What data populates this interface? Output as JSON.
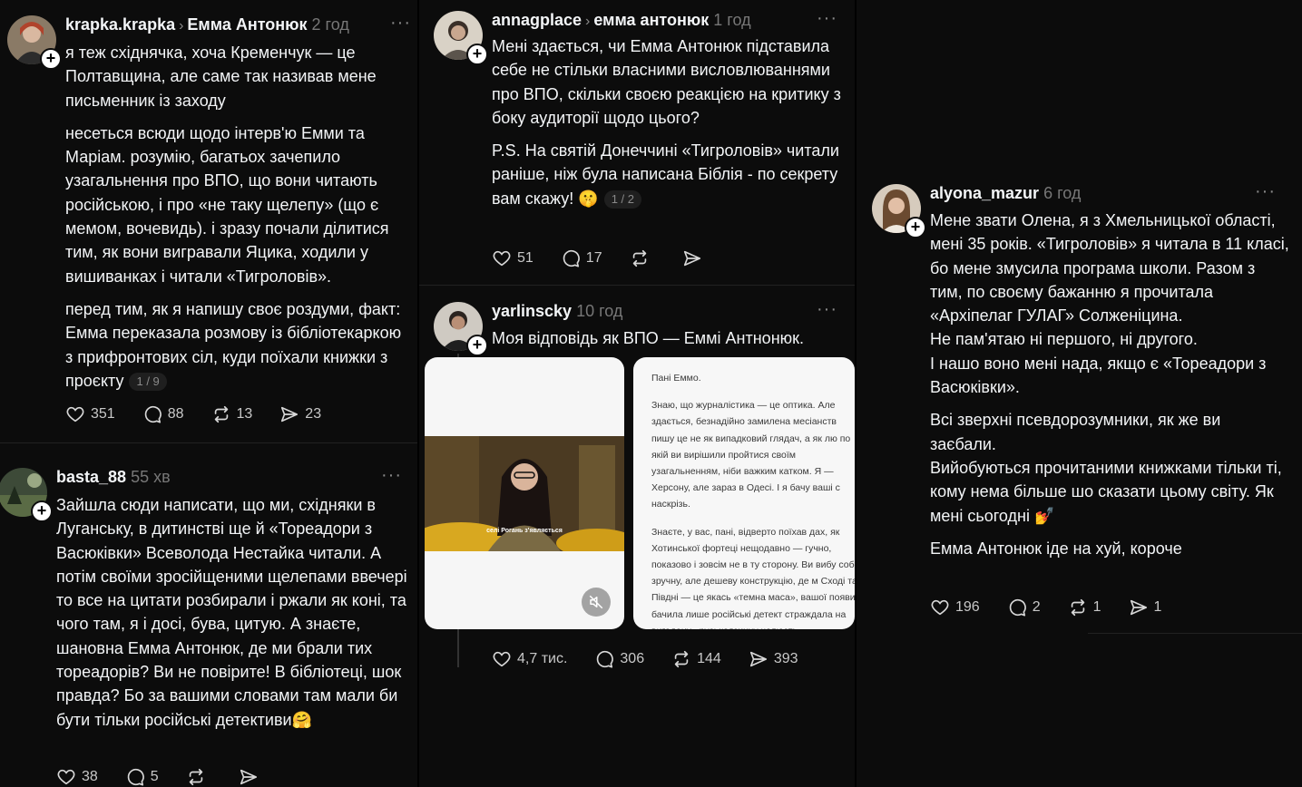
{
  "posts": [
    {
      "username": "krapka.krapka",
      "reply_to": "Емма Антонюк",
      "time": "2 год",
      "paragraphs": [
        "я теж східнячка, хоча Кременчук — це Полтавщина, але саме так називав мене письменник із заходу",
        "несеться всюди щодо інтерв'ю Емми та Маріам. розумію, багатьох зачепило узагальнення про ВПО, що вони читають російською, і про «не таку щелепу» (що є мемом, вочевидь). і зразу почали ділитися тим, як вони вигравали Яцика, ходили у вишиванках і читали «Тигроловів».",
        "перед тим, як я напишу своє роздуми, факт: Емма переказала розмову із бібліотекаркою з прифронтових сіл, куди поїхали книжки з проєкту"
      ],
      "pager": "1 / 9",
      "likes": "351",
      "comments": "88",
      "reposts": "13",
      "shares": "23",
      "avatar": "person-avatar"
    },
    {
      "username": "basta_88",
      "time": "55 хв",
      "paragraphs": [
        "Зайшла сюди написати, що ми, східняки в Луганську, в дитинстві ще й «Тореадори з Васюківки» Всеволода Нестайка читали. А потім своїми зросійщеними щелепами ввечері то все на цитати розбирали і ржали як коні, та чого там, я і досі, бува, цитую. А знаєте, шановна Емма Антонюк, де ми брали тих тореадорів? Ви не повірите! В бібліотеці, шок правда? Бо за вашими словами там мали би бути тільки російські детективи🤗"
      ],
      "likes": "38",
      "comments": "5",
      "avatar": "landscape-avatar"
    },
    {
      "username": "annagplace",
      "reply_to": "емма антонюк",
      "time": "1 год",
      "paragraphs": [
        "Мені здається, чи Емма Антонюк підставила себе не стільки власними висловлюваннями про ВПО, скільки своєю реакцією на критику з боку аудиторії щодо цього?",
        "P.S. На святій Донеччині «Тигроловів» читали раніше, ніж була написана Біблія - по секрету вам скажу! 🤫"
      ],
      "pager": "1 / 2",
      "likes": "51",
      "comments": "17",
      "avatar": "person-avatar"
    },
    {
      "username": "yarlinscky",
      "time": "10 год",
      "paragraphs": [
        "Моя відповідь як ВПО — Еммі Антнонюк."
      ],
      "video_caption": "селі Рогань з'являється",
      "letter": [
        "Пані Еммо.",
        "Знаю, що журналістика — це оптика. Але здається, безнадійно замилена месіанств пишу це не як випадковий глядач, а як лю по якій ви вирішили пройтися своїм узагальненням, ніби важким катком. Я — Херсону, але зараз в Одесі. І я бачу ваші с наскрізь.",
        "Знаєте, у вас, пані, відверто поїхав дах, як Хотинської фортеці нещодавно — гучно, показово і зовсім не в ту сторону. Ви вибу собі зручну, але дешеву конструкцію, де м Сході та Півдні — це якась «темна маса», вашої появи бачила лише російські детект страждала на вигадану «руськоязичну челюсть»."
      ],
      "likes": "4,7 тис.",
      "comments": "306",
      "reposts": "144",
      "shares": "393",
      "avatar": "person-avatar"
    },
    {
      "username": "alyona_mazur",
      "time": "6 год",
      "paragraphs": [
        "Мене звати Олена, я з Хмельницької області, мені 35 років. «Тигроловів» я читала в 11 класі, бо мене змусила програма школи. Разом з тим, по своєму бажанню я прочитала «Архіпелаг ГУЛАГ» Солженіцина.",
        "Не пам'ятаю ні першого, ні другого.",
        "І нашо воно мені нада, якщо є «Тореадори з Васюківки».",
        "Всі зверхні псевдорозумники, як же ви заєбали.",
        "Вийобуються прочитаними книжками тільки ті, кому нема більше шо сказати цьому світу. Як мені сьогодні 💅",
        "Емма Антонюк іде на хуй, короче"
      ],
      "likes": "196",
      "comments": "2",
      "reposts": "1",
      "shares": "1",
      "avatar": "person-avatar"
    }
  ],
  "colors": {
    "background": "#000000",
    "card": "#0c0c0c",
    "text": "#f3f5f7",
    "muted": "#777777"
  }
}
